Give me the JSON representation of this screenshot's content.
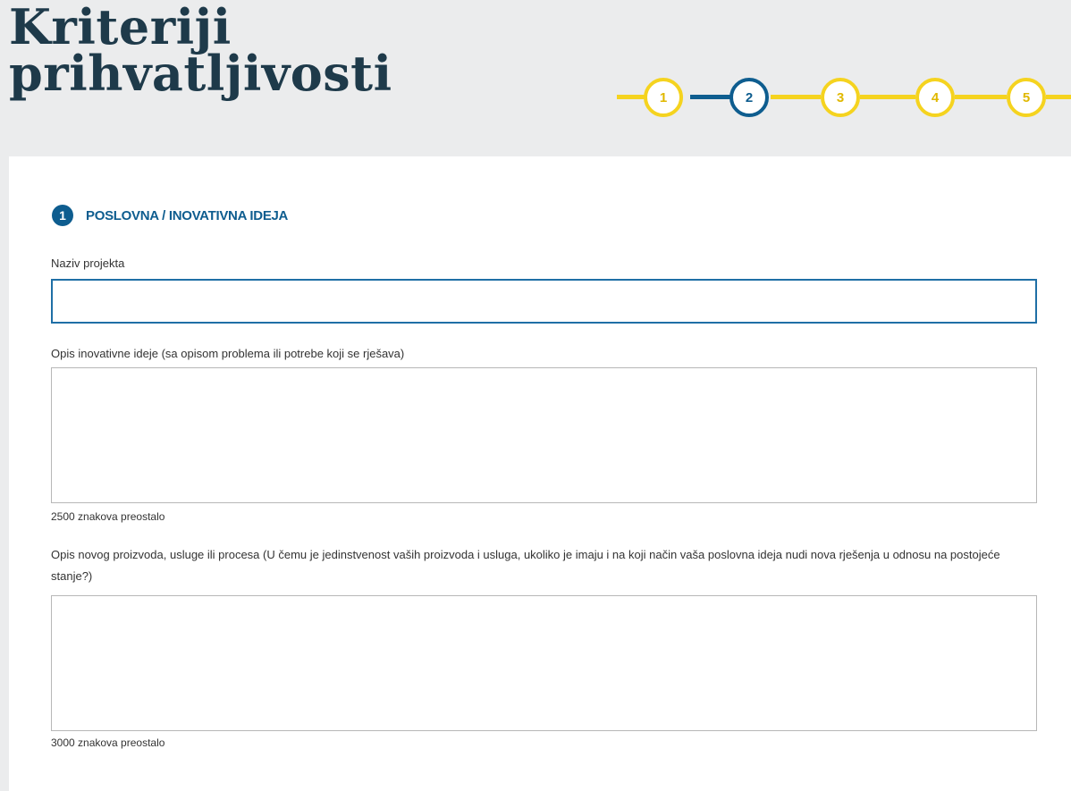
{
  "page": {
    "title_line1": "Kriteriji",
    "title_line2": "prihvatljivosti"
  },
  "stepper": {
    "steps": [
      "1",
      "2",
      "3",
      "4",
      "5"
    ],
    "current_step": 2,
    "colors": {
      "inactive": "#f5d31f",
      "active": "#0e5d8f"
    }
  },
  "section": {
    "number": "1",
    "title": "POSLOVNA / INOVATIVNA IDEJA"
  },
  "form": {
    "project_name": {
      "label": "Naziv projekta",
      "value": ""
    },
    "idea_description": {
      "label": "Opis inovativne ideje (sa opisom problema ili potrebe koji se rješava)",
      "value": "",
      "counter": "2500 znakova preostalo"
    },
    "product_description": {
      "label": "Opis novog proizvoda, usluge ili procesa (U čemu je jedinstvenost vaših proizvoda i usluga, ukoliko je imaju i na koji način vaša poslovna ideja nudi nova rješenja u odnosu na postojeće stanje?)",
      "value": "",
      "counter": "3000 znakova preostalo"
    }
  }
}
